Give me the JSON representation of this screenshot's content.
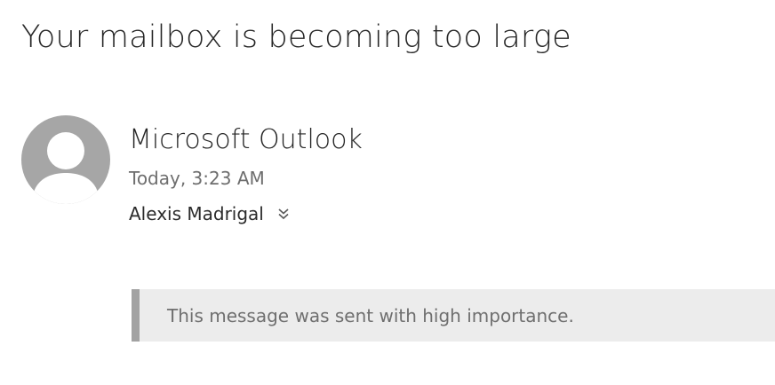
{
  "message": {
    "subject": "Your mailbox is becoming too large",
    "sender": "Microsoft Outlook",
    "timestamp": "Today, 3:23 AM",
    "recipient": "Alexis Madrigal",
    "importance_notice": "This message was sent with high importance."
  },
  "icons": {
    "avatar": "person-icon",
    "expand": "double-chevron-down-icon"
  },
  "colors": {
    "avatar_bg": "#a6a6a6",
    "banner_bg": "#ececec",
    "banner_accent": "#a2a2a2"
  }
}
